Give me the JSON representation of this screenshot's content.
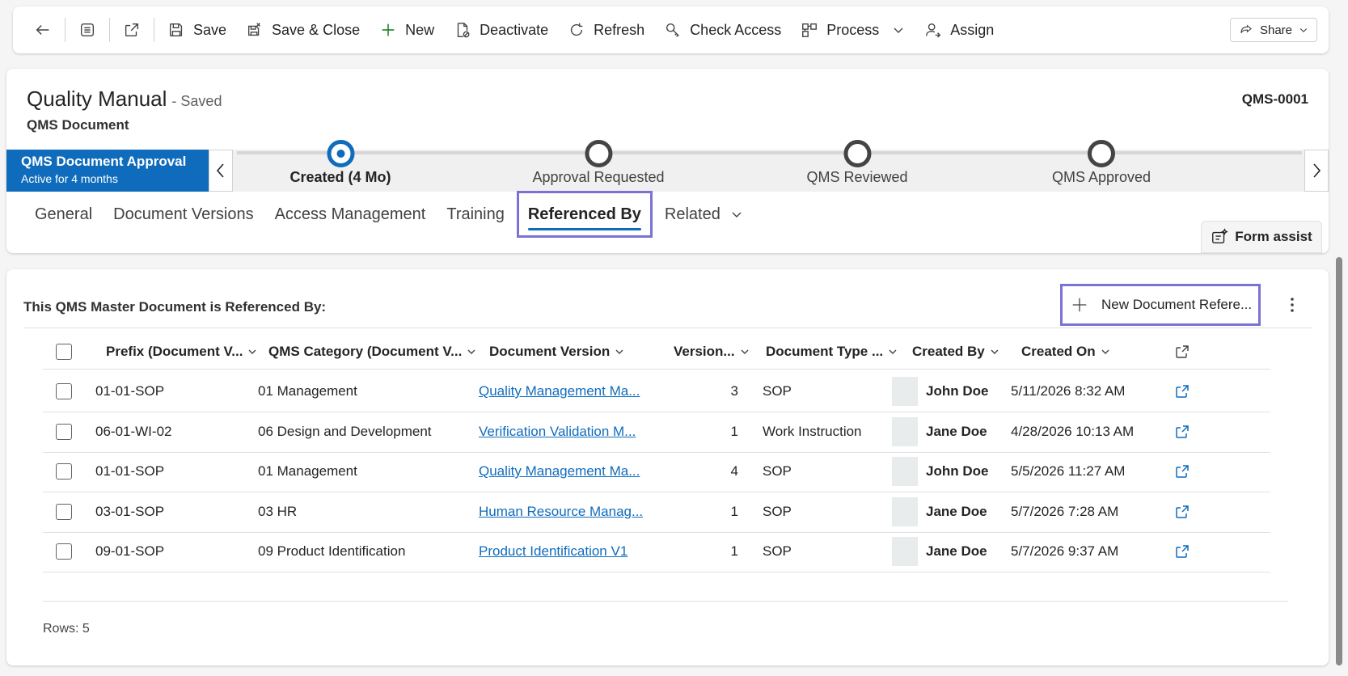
{
  "toolbar": {
    "save": "Save",
    "save_close": "Save & Close",
    "new": "New",
    "deactivate": "Deactivate",
    "refresh": "Refresh",
    "check_access": "Check Access",
    "process": "Process",
    "assign": "Assign",
    "share": "Share"
  },
  "record": {
    "title": "Quality Manual",
    "saved_status": "- Saved",
    "entity": "QMS Document",
    "id": "QMS-0001"
  },
  "process_flow": {
    "name": "QMS Document Approval",
    "duration": "Active for 4 months",
    "stages": [
      {
        "label": "Created  (4 Mo)",
        "active": true
      },
      {
        "label": "Approval Requested",
        "active": false
      },
      {
        "label": "QMS Reviewed",
        "active": false
      },
      {
        "label": "QMS Approved",
        "active": false
      }
    ]
  },
  "tabs": [
    "General",
    "Document Versions",
    "Access Management",
    "Training",
    "Referenced By",
    "Related"
  ],
  "selected_tab": "Referenced By",
  "form_assist": "Form assist",
  "grid": {
    "title": "This QMS Master Document is Referenced By:",
    "new_button": "New Document Refere...",
    "columns": [
      "Prefix (Document V...",
      "QMS Category (Document V...",
      "Document Version",
      "Version...",
      "Document Type ...",
      "Created By",
      "Created On"
    ],
    "rows": [
      {
        "prefix": "01-01-SOP",
        "category": "01 Management",
        "version_name": "Quality Management Ma...",
        "version": "3",
        "type": "SOP",
        "created_by": "John Doe",
        "created_on": "5/11/2026 8:32 AM"
      },
      {
        "prefix": "06-01-WI-02",
        "category": "06 Design and Development",
        "version_name": "Verification Validation M...",
        "version": "1",
        "type": "Work Instruction",
        "created_by": "Jane Doe",
        "created_on": "4/28/2026 10:13 AM"
      },
      {
        "prefix": "01-01-SOP",
        "category": "01 Management",
        "version_name": "Quality Management Ma...",
        "version": "4",
        "type": "SOP",
        "created_by": "John Doe",
        "created_on": "5/5/2026 11:27 AM"
      },
      {
        "prefix": "03-01-SOP",
        "category": "03 HR",
        "version_name": "Human Resource Manag...",
        "version": "1",
        "type": "SOP",
        "created_by": "Jane Doe",
        "created_on": "5/7/2026 7:28 AM"
      },
      {
        "prefix": "09-01-SOP",
        "category": "09 Product Identification",
        "version_name": "Product Identification V1",
        "version": "1",
        "type": "SOP",
        "created_by": "Jane Doe",
        "created_on": "5/7/2026 9:37 AM"
      }
    ],
    "row_count": "Rows: 5"
  },
  "colors": {
    "accent": "#0f6cbd",
    "highlight": "#7b72d8"
  }
}
